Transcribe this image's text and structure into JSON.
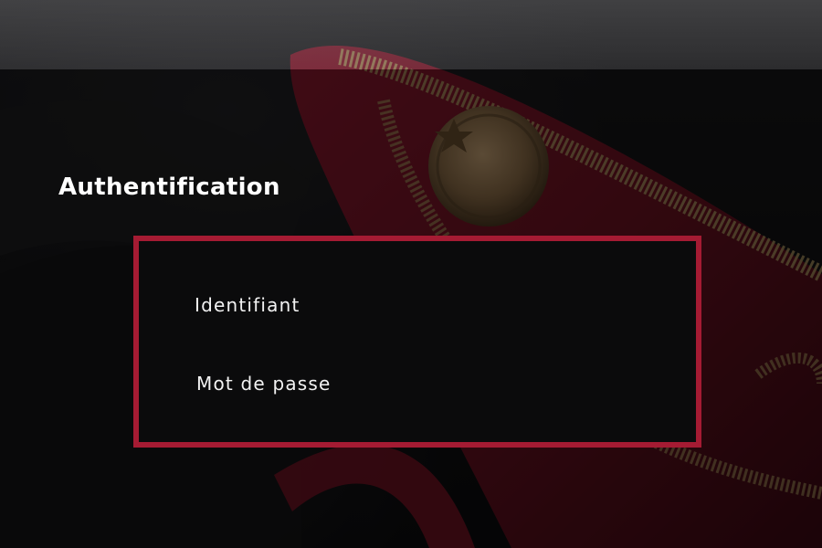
{
  "page": {
    "title": "Authentification"
  },
  "login_form": {
    "username_label": "Identifiant",
    "password_label": "Mot de passe"
  },
  "colors": {
    "panel_border": "#a51b33",
    "panel_background": "#0b0b0c",
    "text": "#ffffff"
  },
  "background": {
    "icon": "epaulette-photo"
  }
}
